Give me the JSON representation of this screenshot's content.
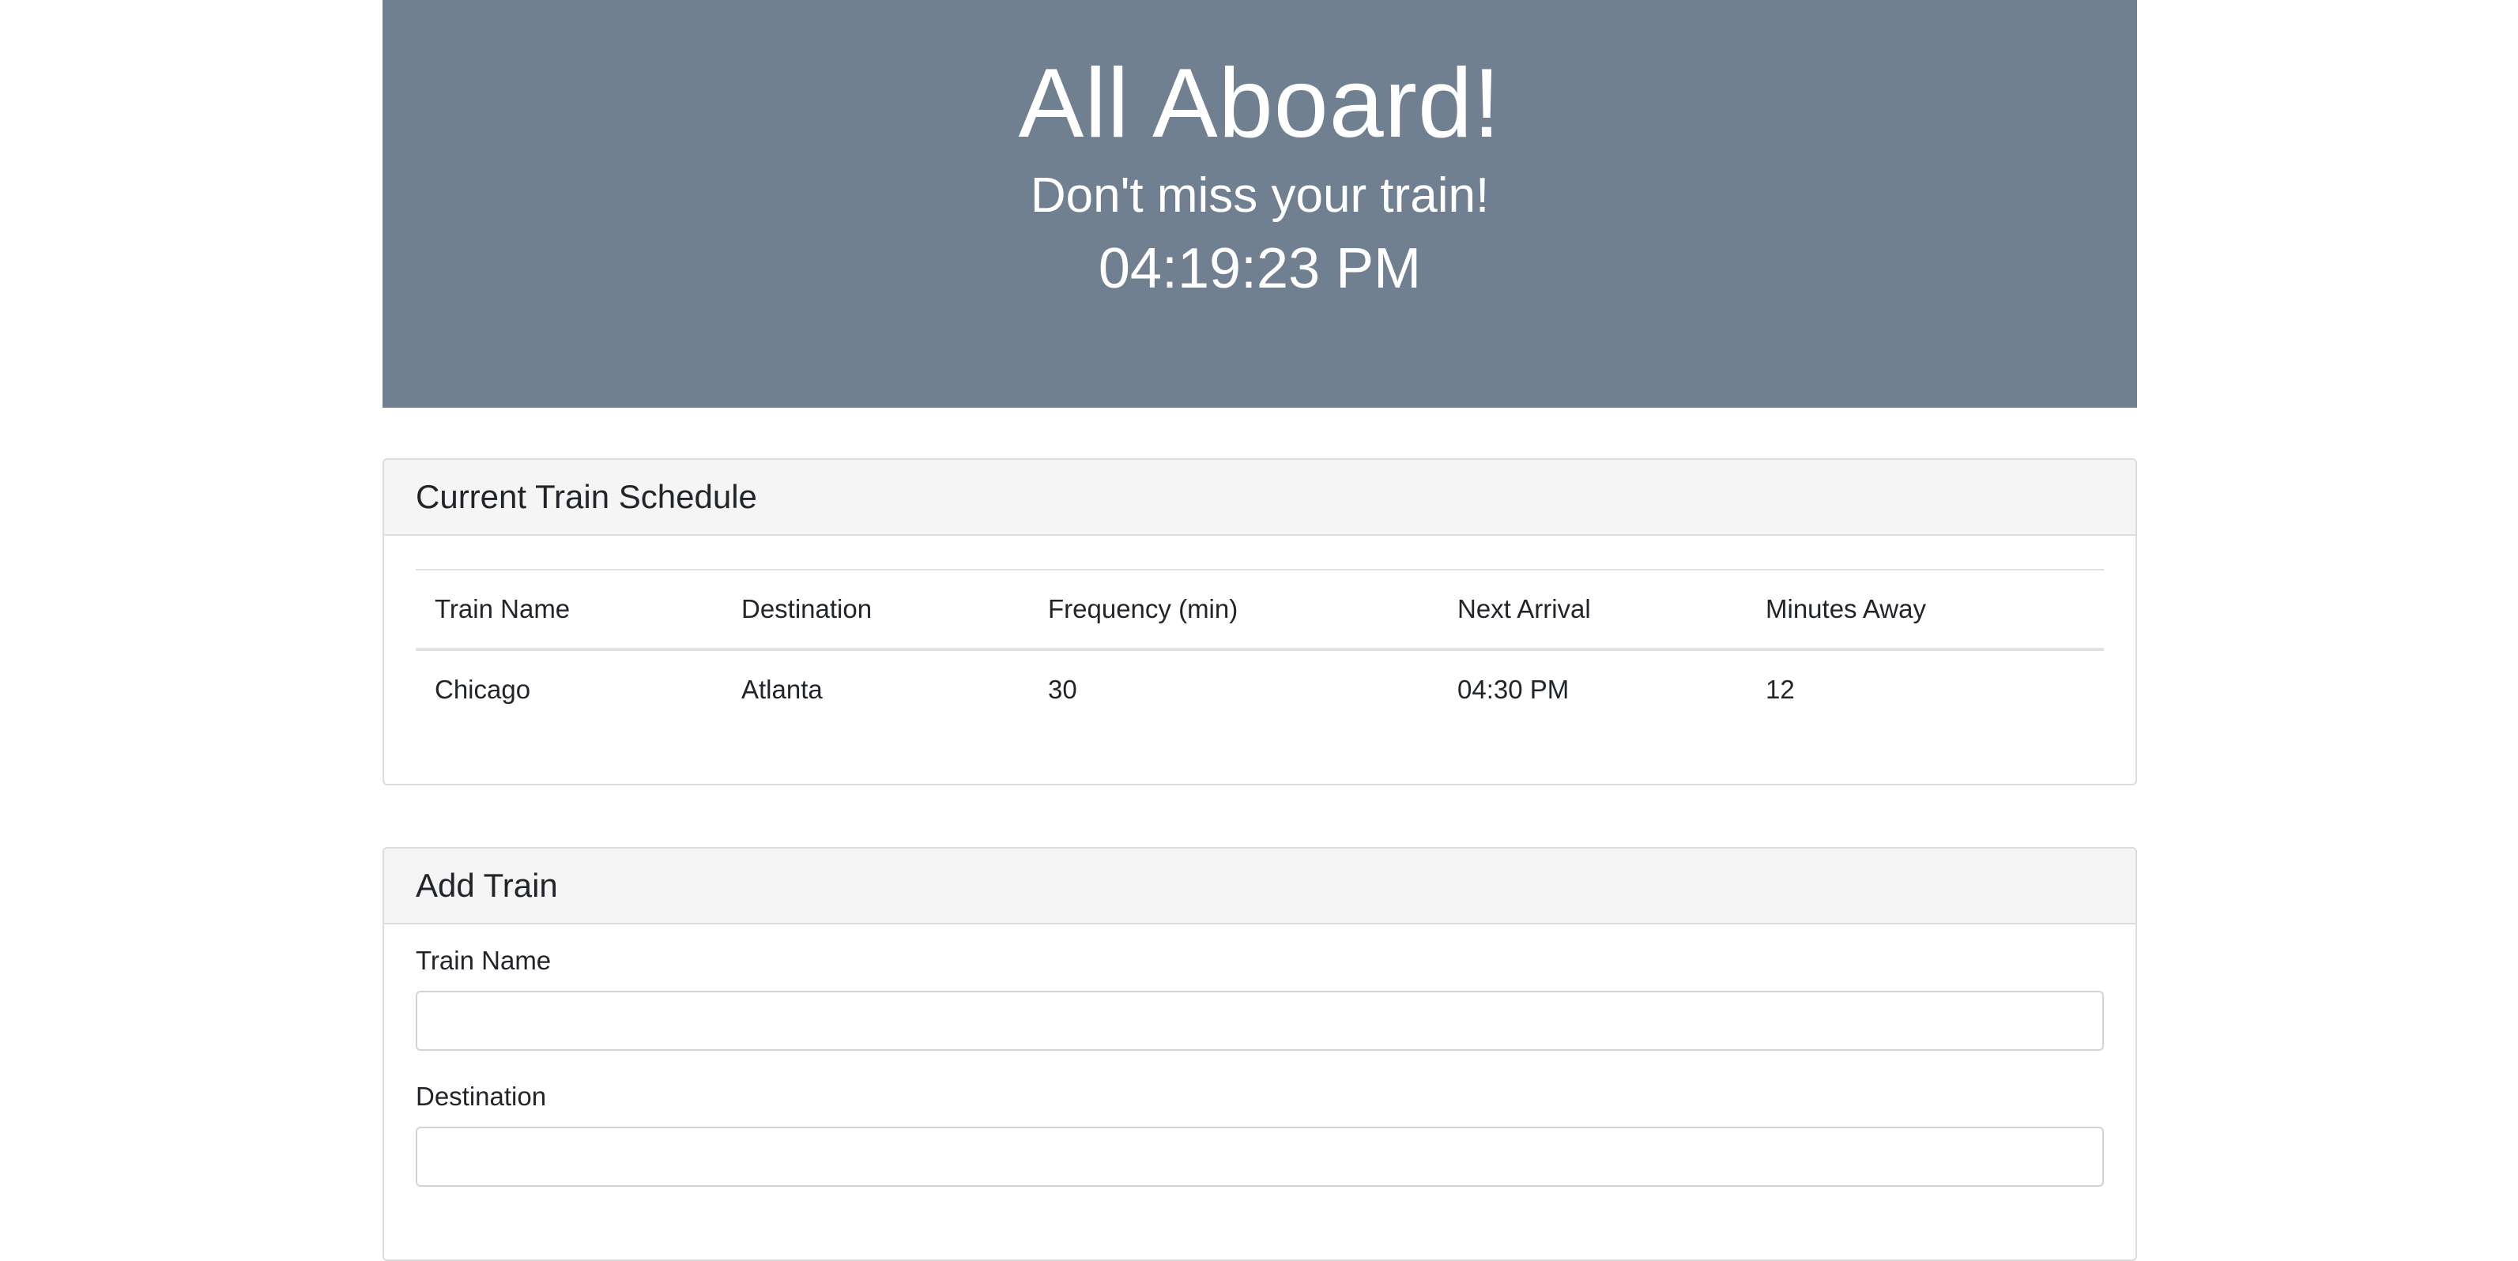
{
  "jumbotron": {
    "title": "All Aboard!",
    "subtitle": "Don't miss your train!",
    "current_time": "04:19:23 PM",
    "background_color": "#708090"
  },
  "schedule": {
    "header": "Current Train Schedule",
    "columns": [
      "Train Name",
      "Destination",
      "Frequency (min)",
      "Next Arrival",
      "Minutes Away"
    ],
    "rows": [
      [
        "Chicago",
        "Atlanta",
        "30",
        "04:30 PM",
        "12"
      ]
    ]
  },
  "add_train": {
    "header": "Add Train",
    "fields": [
      {
        "label": "Train Name",
        "value": "",
        "placeholder": ""
      },
      {
        "label": "Destination",
        "value": "",
        "placeholder": ""
      }
    ]
  }
}
